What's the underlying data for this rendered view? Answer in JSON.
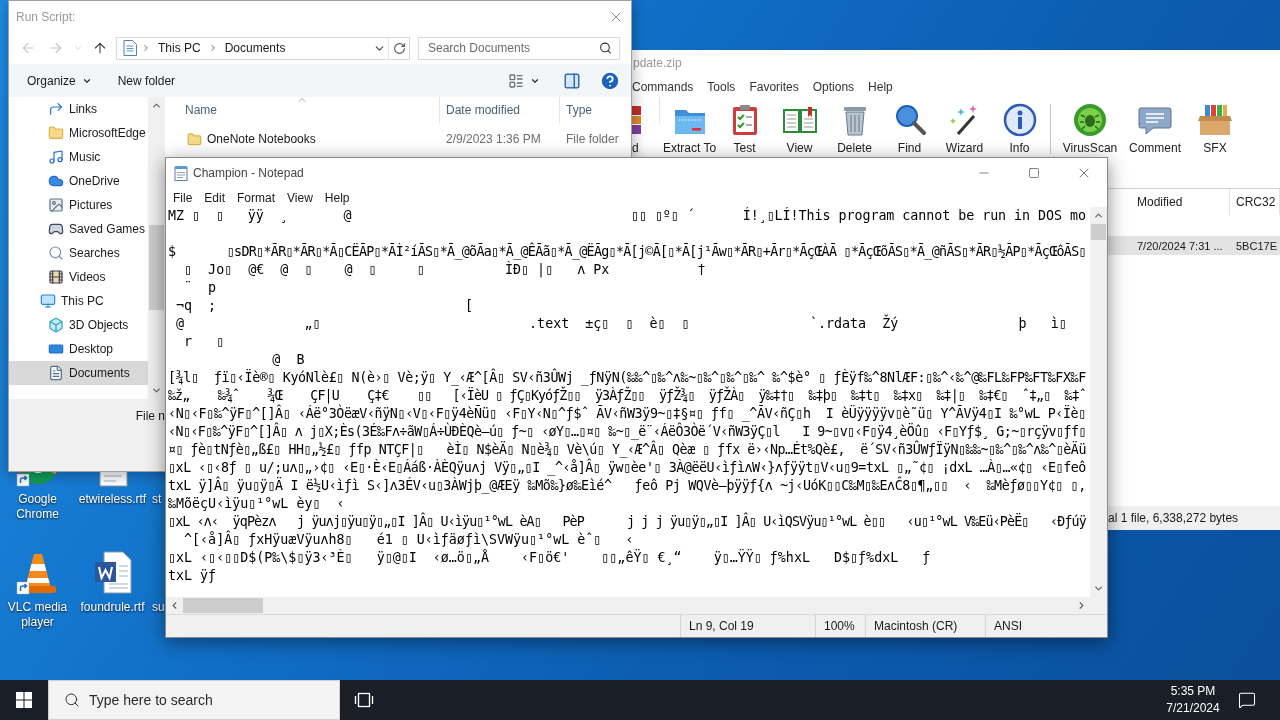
{
  "file_dialog": {
    "title": "Run Script:",
    "nav_buttons": [
      {
        "kind": "back",
        "disabled": true
      },
      {
        "kind": "forward",
        "disabled": true
      },
      {
        "kind": "recent",
        "disabled": true
      },
      {
        "kind": "up",
        "disabled": false
      }
    ],
    "path": [
      "This PC",
      "Documents"
    ],
    "search": {
      "placeholder": "Search Documents"
    },
    "commands": [
      {
        "label": "Organize",
        "kind": "menu"
      },
      {
        "label": "New folder",
        "kind": "plain"
      }
    ],
    "nav_pane": {
      "folders": [
        {
          "label": "Links",
          "kind": "link",
          "selected": false
        },
        {
          "label": "MicrosoftEdge",
          "kind": "folder",
          "selected": false
        },
        {
          "label": "Music",
          "kind": "music",
          "selected": false
        },
        {
          "label": "OneDrive",
          "kind": "cloud",
          "selected": false
        },
        {
          "label": "Pictures",
          "kind": "pictures",
          "selected": false
        },
        {
          "label": "Saved Games",
          "kind": "games",
          "selected": false
        },
        {
          "label": "Searches",
          "kind": "search",
          "selected": false
        },
        {
          "label": "Videos",
          "kind": "videos",
          "selected": false
        }
      ],
      "this_pc": {
        "label": "This PC",
        "kind": "pc",
        "selected": false,
        "children": [
          {
            "label": "3D Objects",
            "kind": "cube",
            "selected": false
          },
          {
            "label": "Desktop",
            "kind": "desktop",
            "selected": false
          },
          {
            "label": "Documents",
            "kind": "documents",
            "selected": true
          }
        ]
      }
    },
    "columns": [
      {
        "label": "Name",
        "sorted": true
      },
      {
        "label": "Date modified",
        "sorted": false
      },
      {
        "label": "Type",
        "sorted": false
      }
    ],
    "rows": [
      {
        "name": "OneNote Notebooks",
        "date_modified": "2/9/2023 1:36 PM",
        "type": "File folder"
      }
    ],
    "file_name_label": "File n"
  },
  "archive_window": {
    "title": "pdate.zip",
    "menu": [
      "Commands",
      "Tools",
      "Favorites",
      "Options",
      "Help"
    ],
    "toolbar_groups": [
      [
        {
          "label": "d",
          "kind": "add"
        },
        {
          "label": "Extract To",
          "kind": "extract"
        },
        {
          "label": "Test",
          "kind": "test"
        },
        {
          "label": "View",
          "kind": "view"
        },
        {
          "label": "Delete",
          "kind": "delete"
        },
        {
          "label": "Find",
          "kind": "find"
        },
        {
          "label": "Wizard",
          "kind": "wizard"
        },
        {
          "label": "Info",
          "kind": "info"
        }
      ],
      [
        {
          "label": "VirusScan",
          "kind": "virus"
        },
        {
          "label": "Comment",
          "kind": "comment"
        },
        {
          "label": "SFX",
          "kind": "sfx"
        }
      ]
    ],
    "columns": [
      "Modified",
      "CRC32"
    ],
    "rows": [
      {
        "modified": "7/20/2024 7:31 ...",
        "crc32": "5BC17E",
        "selected": true
      }
    ],
    "status": "al 1 file, 6,338,272 bytes"
  },
  "notepad": {
    "title": "Champion - Notepad",
    "menu": [
      "File",
      "Edit",
      "Format",
      "View",
      "Help"
    ],
    "text": "MZ ▯  ▯   ÿÿ  ¸       @                                   ▯▯ ▯º▯ ´      Í!¸▯LÍ!This program cannot be run in DOS mo\n\n$       ▯sDR▯*ÃR▯*ÃR▯*Ã▯CËÃP▯*ÃÌ²íÃS▯*Ã_@õÃa▯*Ã_@ÊÃã▯*Ã_@ËÃg▯*Ã[j©Ã[▯*Ã[j¹Ãw▯*ÃR▯+Ãr▯*ÃçŒÀÃ ▯*ÃçŒõÃS▯*Ã_@ñÃS▯*ÃR▯½ÃP▯*ÃçŒôÃS▯\n  ▯  Jo▯  @€  @  ▯    @  ▯     ▯          ÌÐ▯ |▯   ʌ Px           †\n  ¨  p\n ¬q  ;                               [\n @               „▯                          .text  ±ç▯  ▯  è▯  ▯               `.rdata  Žý               þ   ì▯\n  r   ▯\n             @  B\n[¾l▯  ƒï▯‹Ïè®▯ KyóNlè£▯ N(è›▯ Vè;ÿ▯ Y_‹Æ^[Â▯ SV‹ñ3ÛWj _ƒNÿN(‰‰^▯‰^ʌ‰~▯‰^▯‰^▯‰^ ‰^$è° ▯ ƒÈÿf‰^8NlÆF:▯‰^‹‰^@‰FL‰FP‰FT‰FX‰F\n‰ž„    ‰¾ˆ    ¾Œ    ÇF|U    Ç‡€    ▯▯   [‹ÏèU ▯ ƒÇ▯KyóƒŽ▯▯  ÿ3ÀƒŽ▯▯  ÿƒŽ¾▯  ÿƒŽÀ▯  ÿ‰‡†▯  ‰‡þ▯  ‰‡t▯  ‰‡x▯  ‰‡|▯  ‰‡€▯  ˆ‡„▯  ‰‡ˆ\n‹N▯‹F▯‰^ÿF▯^[]Â▯ ‹Áë°3ÒëæV‹ñÿN▯‹V▯‹F▯ÿ4èÑü▯ ‹F▯Y‹N▯^ƒ$ˆ ÃV‹ñW3ÿ9~▯‡§¤▯ ƒf▯ _^ÃV‹ñÇ▯h  I èÜÿÿÿÿv▯è˜ü▯ Y^ÃVÿ4▯I ‰°wL P‹Ïè▯\n‹N▯‹F▯‰^ÿF▯^[]Â▯ ʌ j▯X;Ès(3É‰Fʌ÷ãW▯Á÷ÙÐÈQè–ú▯ ƒ~▯ ‹øY▯…▯¤▯ ‰~▯_ë¨‹ÁëÔ3Òë´V‹ñW3ÿÇ▯l   I 9~▯v▯‹F▯ÿ4¸èÖû▯ ‹F▯Yƒ$¸ G;~▯rçÿv▯ƒf▯\n¤▯ ƒè▯tNƒè▯„ß£▯ HH▯„½£▯ ƒfp NTÇF|▯   èÌ▯ N$èÄ▯ N▯è¾▯ Vè\\ú▯ Y_‹Æ^Â▯ Qèæ ▯ ƒfx ë›‹Np…Ét%Qè£,  ë´SV‹ñ3ÛWƒÏÿN▯‰‰~▯‰^▯‰^ʌ‰^▯èÄü\n▯xL ‹▯‹8ƒ ▯ u/;uʌ▯„›¢▯ ‹E▯·È‹E▯Ááß·ÀÈQÿuʌj Vÿ▯„▯I _^‹å]Â▯ ÿw▯èe'▯ 3À@ëëU‹ìƒìʌW‹}ʌƒÿÿt▯V‹u▯9=txL ▯„˜¢▯ ¡dxL …À▯…«¢▯ ‹E▯feô\ntxL ÿ]Â▯ ÿu▯ÿ▯Ä I ë½U‹ìƒì S‹]ʌ3ÉV‹u▯3ÀWjþ_@ÆEÿ ‰Mõ‰}ø‰Eìé^   ƒeô Pj WQVè–þÿÿƒ{ʌ ~j‹UóK▯▯C‰M▯‰EʌĈ8▯¶„▯▯  ‹  ‰Mèƒø▯▯Y¢▯ ▯,\n‰MõëçU‹ìÿu▯¹°wL èy▯  ‹\n▯xL ‹ʌ‹  ÿqPèzʌ   j ÿuʌj▯ÿu▯ÿ▯„▯I ]Â▯ U‹ìÿu▯¹°wL èA▯   PèP      j j j ÿu▯ÿ▯„▯I ]Â▯ U‹ìQSVÿu▯¹°wL è▯▯   ‹u▯¹°wL V‰Eü‹PèË▯   ‹Ðƒúÿ\n  ^[‹å]Â▯ ƒxHÿuæVÿuʌh8▯   é1 ▯ U‹ìƒäøƒì\\SVWÿu▯¹°wL èˆ▯   ‹\n▯xL ‹▯‹▯▯D$(P‰\\$▯ÿ3‹³È▯   ÿ▯@▯I  ‹ø…ö▯„Å    ‹F▯ö€'    ▯▯„êŸ▯ €¸“    ÿ▯…ŸŸ▯ ƒ%hxL   D$▯ƒ%dxL   ƒ\ntxL ÿƒ",
    "status": [
      "Ln 9, Col 19",
      "100%",
      "Macintosh (CR)",
      "ANSI"
    ]
  },
  "desktop_icons": [
    {
      "label": "Google Chrome",
      "kind": "browser"
    },
    {
      "label": "etwireless.rtf",
      "kind": "document"
    },
    {
      "label": "st",
      "kind": "covered"
    },
    {
      "label": "VLC media player",
      "kind": "player"
    },
    {
      "label": "foundrule.rtf",
      "kind": "word"
    },
    {
      "label": "su",
      "kind": "covered"
    }
  ],
  "taskbar": {
    "search": {
      "placeholder": "Type here to search"
    },
    "time": "5:35 PM",
    "date": "7/21/2024"
  }
}
